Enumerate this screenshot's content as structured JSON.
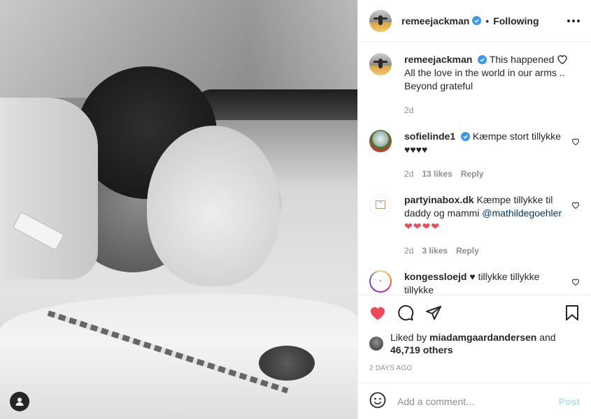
{
  "post": {
    "author": "remeejackman",
    "follow_status": "Following",
    "separator": "•",
    "caption": {
      "username": "remeejackman",
      "text_before_icon": "This happened",
      "text_after_icon": "All the love in the world in our arms .. Beyond grateful",
      "age": "2d"
    },
    "comments": [
      {
        "username": "sofielinde1",
        "verified": true,
        "text": "Kæmpe stort tillykke ♥♥♥♥",
        "age": "2d",
        "likes": "13 likes",
        "reply": "Reply"
      },
      {
        "username": "partyinabox.dk",
        "text": "Kæmpe tillykke til daddy og mammi",
        "mention": "@mathildegoehler",
        "emoji": "❤❤❤❤",
        "age": "2d",
        "likes": "3 likes",
        "reply": "Reply"
      },
      {
        "username": "kongessloejd",
        "text": "♥ tillykke tillykke tillykke"
      }
    ],
    "liked_by_prefix": "Liked by",
    "liked_by_user": "miadamgaardandersen",
    "liked_by_and": "and",
    "liked_by_count": "46,719 others",
    "time_ago": "2 DAYS AGO",
    "comment_placeholder": "Add a comment...",
    "post_button": "Post"
  },
  "colors": {
    "like_red": "#ed4956",
    "verified_blue": "#3897f0",
    "post_disabled": "#b2dffc",
    "muted": "#8e8e8e"
  },
  "icons": {
    "like": "heart-filled-icon",
    "comment": "comment-bubble-icon",
    "share": "paper-plane-icon",
    "save": "bookmark-icon",
    "emoji": "smiley-icon",
    "more": "more-options-icon",
    "tag": "user-tag-icon"
  }
}
